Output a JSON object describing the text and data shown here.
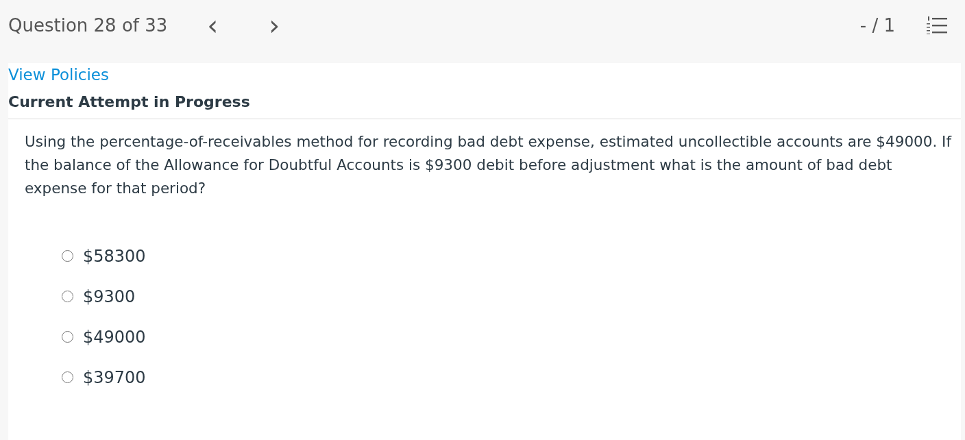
{
  "header": {
    "question_counter": "Question 28 of 33",
    "prev_button": "‹",
    "next_button": "›",
    "score": "- / 1"
  },
  "policies_link": "View Policies",
  "attempt_status": "Current Attempt in Progress",
  "question": {
    "text": "Using the percentage-of-receivables method for recording bad debt expense, estimated uncollectible accounts are $49000. If the balance of the Allowance for Doubtful Accounts is $9300 debit before adjustment what is the amount of bad debt expense for that period?",
    "choices": [
      {
        "label": "$58300",
        "selected": false
      },
      {
        "label": "$9300",
        "selected": false
      },
      {
        "label": "$49000",
        "selected": false
      },
      {
        "label": "$39700",
        "selected": false
      }
    ]
  }
}
